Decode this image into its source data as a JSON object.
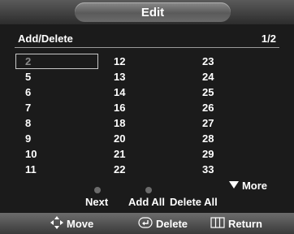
{
  "title": "Edit",
  "header": {
    "title": "Add/Delete",
    "page": "1/2"
  },
  "channels": {
    "col1": [
      "2",
      "5",
      "6",
      "7",
      "8",
      "9",
      "10",
      "11"
    ],
    "col2": [
      "12",
      "13",
      "14",
      "16",
      "18",
      "20",
      "21",
      "22"
    ],
    "col3": [
      "23",
      "24",
      "25",
      "26",
      "27",
      "28",
      "29",
      "33"
    ],
    "selected": "2"
  },
  "more_label": "More",
  "buttons": {
    "next": "Next",
    "add_all": "Add All",
    "delete_all": "Delete All"
  },
  "footer": {
    "move": "Move",
    "delete": "Delete",
    "return": "Return"
  },
  "icons": {
    "move": "move-arrows-icon",
    "delete": "enter-icon",
    "return": "menu-icon",
    "more": "triangle-down-icon"
  }
}
